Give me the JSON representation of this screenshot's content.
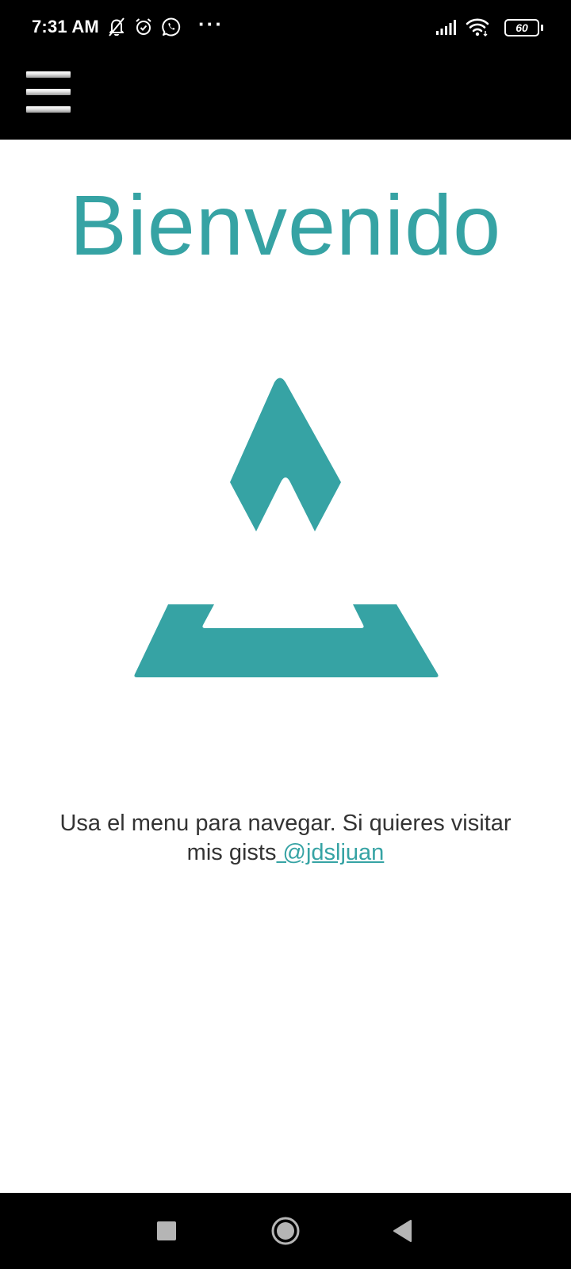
{
  "status_bar": {
    "time": "7:31 AM",
    "icons": [
      "muted-notifications-icon",
      "alarm-icon",
      "whatsapp-icon",
      "more-notifications-icon",
      "signal-icon",
      "wifi-icon"
    ],
    "more_dots": "···",
    "battery_level": "60"
  },
  "app_bar": {
    "menu_icon": "hamburger-menu-icon"
  },
  "main": {
    "title": "Bienvenido",
    "logo_icon": "app-logo",
    "description_text": "Usa el menu para navegar. Si quieres visitar mis gists",
    "link_icon_glyph": "",
    "link_text": "@jdsljuan"
  },
  "nav_bar": {
    "buttons": [
      "recents-square-icon",
      "home-circle-icon",
      "back-triangle-icon"
    ]
  },
  "colors": {
    "accent": "#36A3A4",
    "bar_background": "#000000",
    "page_background": "#ffffff",
    "body_text": "#333333"
  }
}
